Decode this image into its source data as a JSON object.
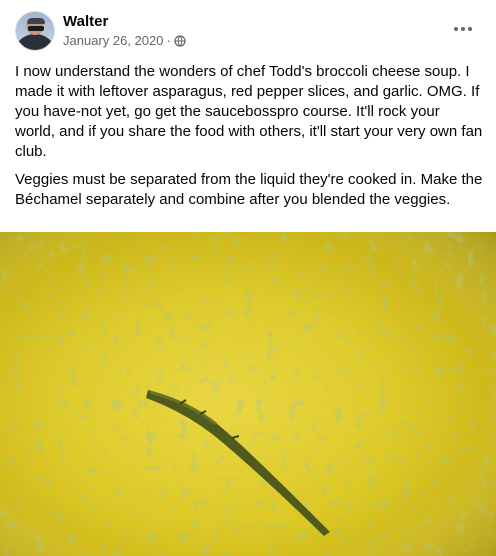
{
  "post": {
    "author": "Walter",
    "date": "January 26, 2020",
    "separator": "·",
    "privacy_icon": "public-globe-icon",
    "more_icon": "more-options-icon",
    "paragraphs": [
      "I now understand the wonders of chef Todd's broccoli cheese soup. I made it with leftover asparagus, red pepper slices, and garlic. OMG. If you have-not yet, go get the saucebosspro course. It'll rock your world, and if you share the food with others, it'll start your very own fan club.",
      "Veggies must be separated from the liquid they're cooked in. Make the Béchamel separately and combine after you blended the veggies."
    ]
  },
  "colors": {
    "name": "#050505",
    "meta": "#65676b",
    "soup": "#dcc821",
    "asparagus": "#4f5a1c"
  }
}
